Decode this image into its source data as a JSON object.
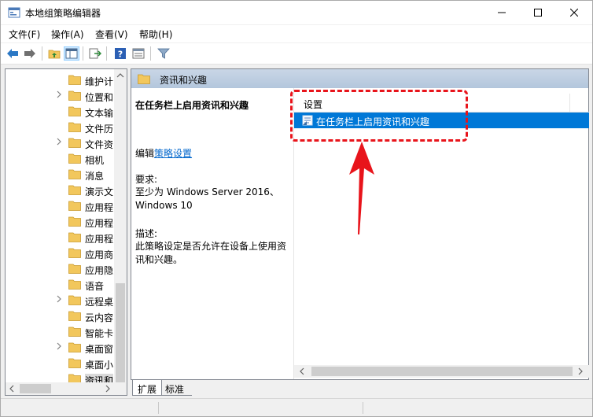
{
  "window": {
    "title": "本地组策略编辑器",
    "controls": {
      "minimize": "—",
      "maximize": "☐",
      "close": "✕"
    }
  },
  "menu": [
    {
      "label": "文件(F)"
    },
    {
      "label": "操作(A)"
    },
    {
      "label": "查看(V)"
    },
    {
      "label": "帮助(H)"
    }
  ],
  "toolbar": {
    "buttons": [
      "back-icon",
      "forward-icon",
      "up-folder-icon",
      "show-hide-tree-icon",
      "export-list-icon",
      "help-icon",
      "properties-view-icon",
      "filter-icon"
    ]
  },
  "tree": {
    "items": [
      {
        "label": "维护计",
        "expandable": false
      },
      {
        "label": "位置和",
        "expandable": true
      },
      {
        "label": "文本输",
        "expandable": false
      },
      {
        "label": "文件历",
        "expandable": false
      },
      {
        "label": "文件资",
        "expandable": true
      },
      {
        "label": "相机",
        "expandable": false
      },
      {
        "label": "消息",
        "expandable": false
      },
      {
        "label": "演示文",
        "expandable": false
      },
      {
        "label": "应用程",
        "expandable": false
      },
      {
        "label": "应用程",
        "expandable": false
      },
      {
        "label": "应用程",
        "expandable": false
      },
      {
        "label": "应用商",
        "expandable": false
      },
      {
        "label": "应用隐",
        "expandable": false
      },
      {
        "label": "语音",
        "expandable": false
      },
      {
        "label": "远程桌",
        "expandable": true
      },
      {
        "label": "云内容",
        "expandable": false
      },
      {
        "label": "智能卡",
        "expandable": false
      },
      {
        "label": "桌面窗",
        "expandable": true
      },
      {
        "label": "桌面小",
        "expandable": false
      },
      {
        "label": "资讯和",
        "expandable": false,
        "selected": true
      }
    ]
  },
  "right": {
    "header": "资讯和兴趣",
    "description": {
      "title": "在任务栏上启用资讯和兴趣",
      "edit_prefix": "编辑",
      "edit_link": "策略设置",
      "requirements_label": "要求:",
      "requirements_text": "至少为 Windows Server 2016、Windows 10",
      "description_label": "描述:",
      "description_text": "此策略设定是否允许在设备上使用资讯和兴趣。"
    },
    "list": {
      "column": "设置",
      "rows": [
        {
          "label": "在任务栏上启用资讯和兴趣",
          "selected": true
        }
      ]
    }
  },
  "tabs": [
    {
      "label": "扩展",
      "active": true
    },
    {
      "label": "标准",
      "active": false
    }
  ],
  "colors": {
    "selection": "#0078d7",
    "annotation": "#e8141b",
    "header_band": "#b3c6dc",
    "folder": "#f2c75c"
  }
}
